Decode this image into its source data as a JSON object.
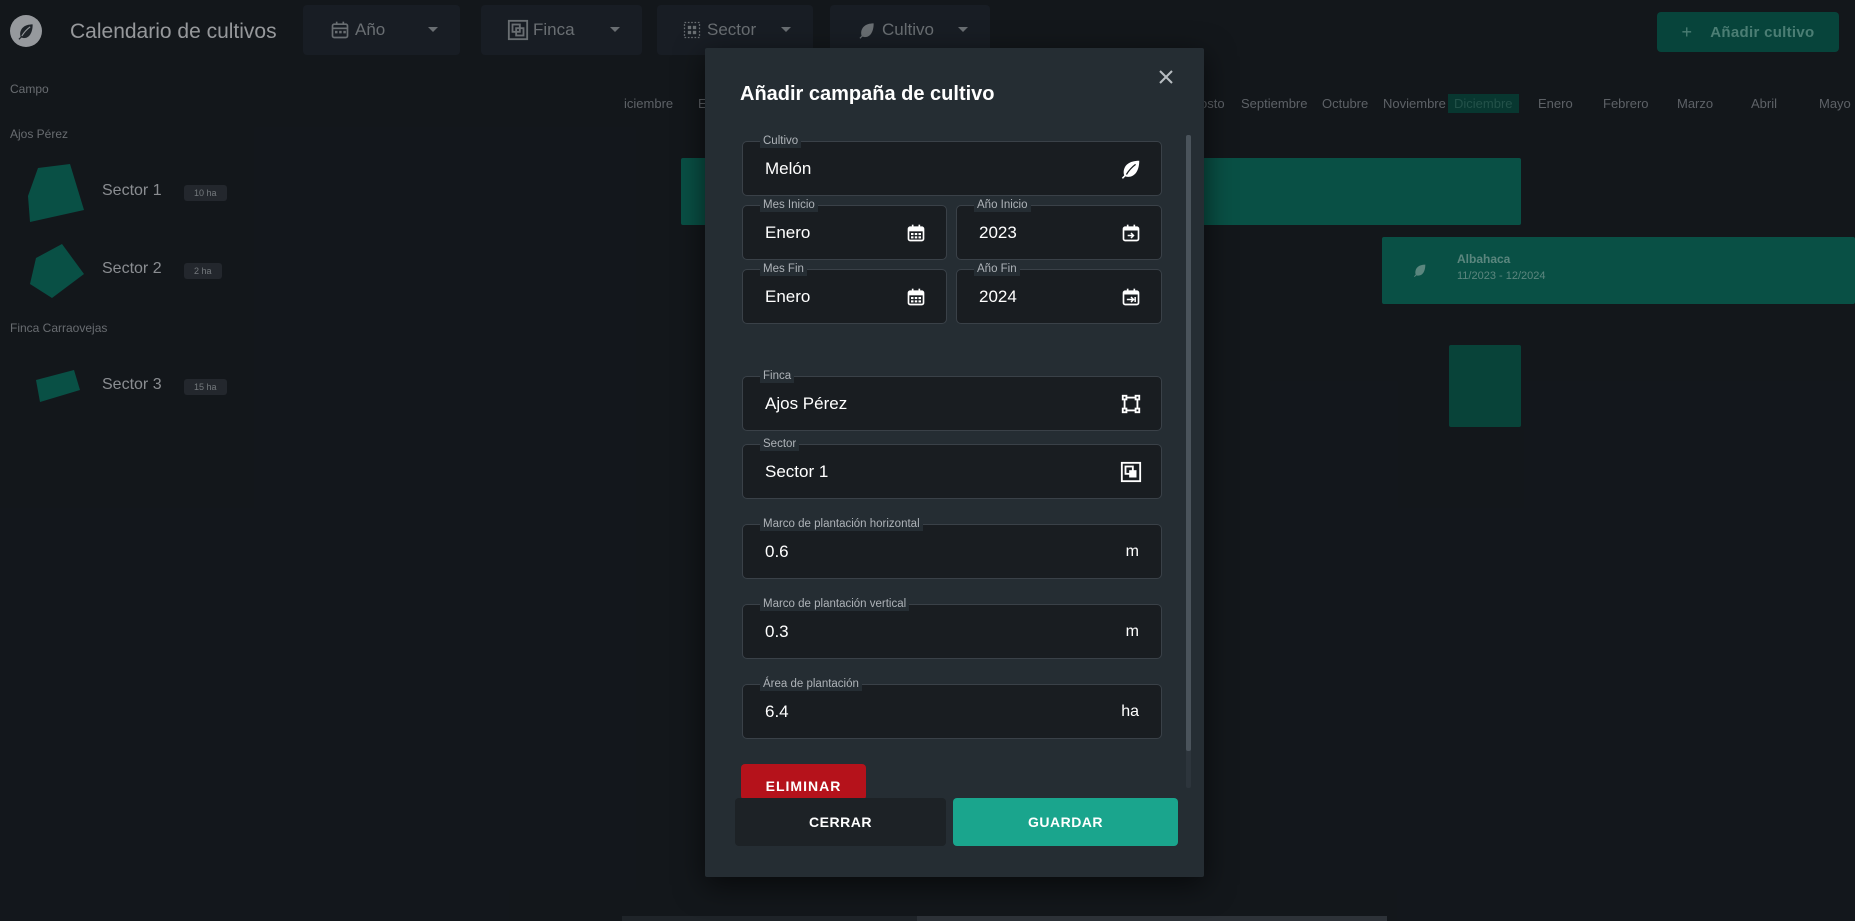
{
  "header": {
    "app_title": "Calendario de cultivos",
    "filters": [
      {
        "label": "Año",
        "icon": "calendar-icon"
      },
      {
        "label": "Finca",
        "icon": "finca-icon"
      },
      {
        "label": "Sector",
        "icon": "sector-grid-icon"
      },
      {
        "label": "Cultivo",
        "icon": "leaf-icon"
      }
    ],
    "add_button_label": "Añadir cultivo",
    "add_button_icon": "+"
  },
  "sidebar": {
    "header": "Campo",
    "fincas": [
      {
        "name": "Ajos Pérez",
        "sectors": [
          {
            "name": "Sector 1",
            "area": "10 ha"
          },
          {
            "name": "Sector 2",
            "area": "2 ha"
          }
        ]
      },
      {
        "name": "Finca Carraovejas",
        "sectors": [
          {
            "name": "Sector 3",
            "area": "15 ha"
          }
        ]
      }
    ]
  },
  "timeline": {
    "months": [
      "iciembre",
      "E",
      "osto",
      "Septiembre",
      "Octubre",
      "Noviembre",
      "Diciembre",
      "Enero",
      "Febrero",
      "Marzo",
      "Abril",
      "Mayo"
    ],
    "highlighted_month": "Diciembre",
    "entries": [
      {
        "crop": "Albahaca",
        "range": "11/2023 - 12/2024"
      }
    ]
  },
  "modal": {
    "title": "Añadir campaña de cultivo",
    "fields": {
      "cultivo": {
        "label": "Cultivo",
        "value": "Melón"
      },
      "mes_inicio": {
        "label": "Mes Inicio",
        "value": "Enero"
      },
      "anio_inicio": {
        "label": "Año Inicio",
        "value": "2023"
      },
      "mes_fin": {
        "label": "Mes Fin",
        "value": "Enero"
      },
      "anio_fin": {
        "label": "Año Fin",
        "value": "2024"
      },
      "finca": {
        "label": "Finca",
        "value": "Ajos Pérez"
      },
      "sector": {
        "label": "Sector",
        "value": "Sector 1"
      },
      "marco_h": {
        "label": "Marco de plantación horizontal",
        "value": "0.6",
        "unit": "m"
      },
      "marco_v": {
        "label": "Marco de plantación vertical",
        "value": "0.3",
        "unit": "m"
      },
      "area": {
        "label": "Área de plantación",
        "value": "6.4",
        "unit": "ha"
      }
    },
    "delete_label": "ELIMINAR",
    "close_label": "CERRAR",
    "save_label": "GUARDAR"
  },
  "colors": {
    "background": "#1a1f25",
    "accent": "#1aa58d",
    "bar": "#0d6b5d",
    "danger": "#b5121b"
  }
}
